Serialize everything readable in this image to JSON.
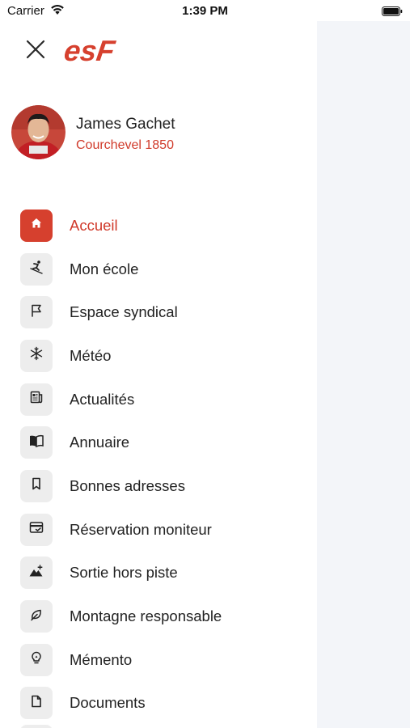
{
  "status_bar": {
    "carrier": "Carrier",
    "time": "1:39 PM"
  },
  "header": {
    "logo_text": "esF",
    "brand_color": "#d6402e"
  },
  "profile": {
    "name": "James Gachet",
    "location": "Courchevel 1850"
  },
  "menu": {
    "items": [
      {
        "label": "Accueil",
        "icon": "home-icon",
        "active": true
      },
      {
        "label": "Mon école",
        "icon": "skier-icon",
        "active": false
      },
      {
        "label": "Espace syndical",
        "icon": "flag-icon",
        "active": false
      },
      {
        "label": "Météo",
        "icon": "snowflake-icon",
        "active": false
      },
      {
        "label": "Actualités",
        "icon": "newspaper-icon",
        "active": false
      },
      {
        "label": "Annuaire",
        "icon": "book-icon",
        "active": false
      },
      {
        "label": "Bonnes adresses",
        "icon": "bookmark-icon",
        "active": false
      },
      {
        "label": "Réservation moniteur",
        "icon": "card-check-icon",
        "active": false
      },
      {
        "label": "Sortie hors piste",
        "icon": "mountain-icon",
        "active": false
      },
      {
        "label": "Montagne responsable",
        "icon": "leaf-icon",
        "active": false
      },
      {
        "label": "Mémento",
        "icon": "lightbulb-icon",
        "active": false
      },
      {
        "label": "Documents",
        "icon": "document-icon",
        "active": false
      }
    ]
  },
  "colors": {
    "accent": "#d6402e",
    "icon_bg": "#ededed",
    "backdrop": "#f3f5f9"
  }
}
